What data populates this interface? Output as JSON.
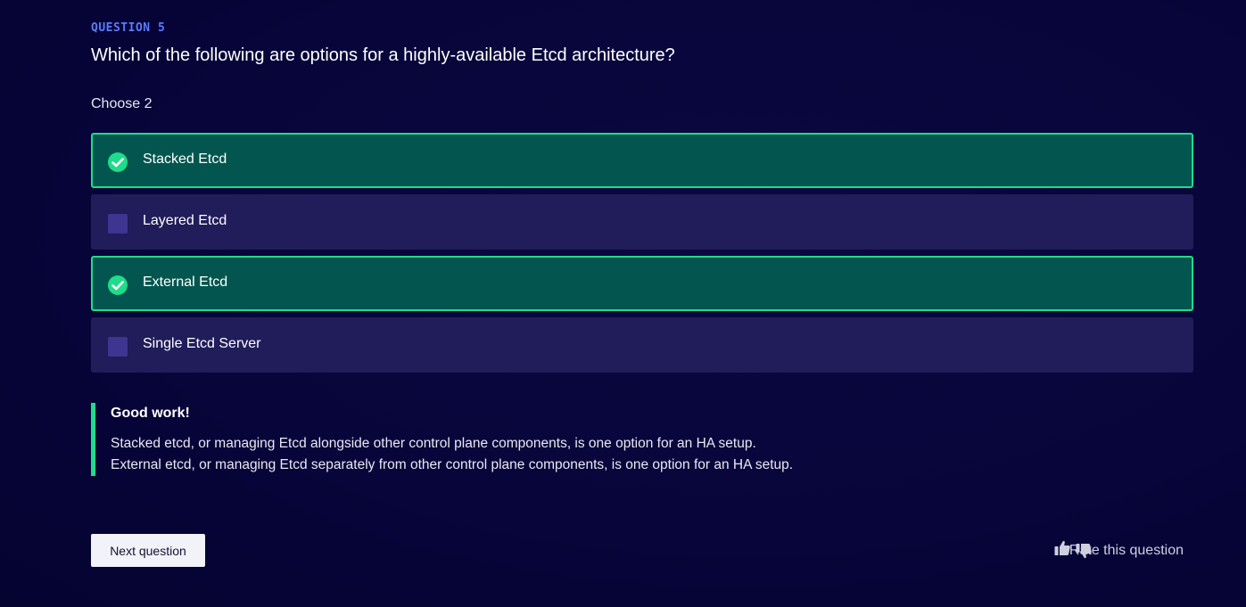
{
  "question": {
    "number_label": "QUESTION 5",
    "title": "Which of the following are options for a highly-available Etcd architecture?",
    "instruction": "Choose 2"
  },
  "options": [
    {
      "label": "Stacked Etcd",
      "selected": true
    },
    {
      "label": "Layered Etcd",
      "selected": false
    },
    {
      "label": "External Etcd",
      "selected": true
    },
    {
      "label": "Single Etcd Server",
      "selected": false
    }
  ],
  "feedback": {
    "title": "Good work!",
    "lines": [
      "Stacked etcd, or managing Etcd alongside other control plane components, is one option for an HA setup.",
      "External etcd, or managing Etcd separately from other control plane components, is one option for an HA setup."
    ]
  },
  "actions": {
    "next_label": "Next question",
    "rate_label": "Rate this question",
    "thumb_up_icon": "thumbs-up-icon",
    "thumb_down_icon": "thumbs-down-icon"
  },
  "colors": {
    "background": "#07053a",
    "accent_blue": "#5b7bff",
    "selected_bg": "#035650",
    "selected_border": "#1fdc8a",
    "unselected_bg": "#211c5a",
    "checkbox_empty": "#3d3590"
  }
}
